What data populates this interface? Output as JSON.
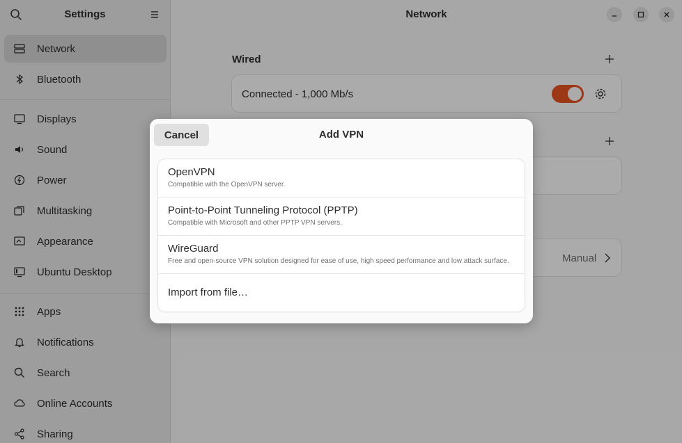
{
  "sidebar": {
    "title": "Settings",
    "items": [
      {
        "label": "Network",
        "icon": "network-icon",
        "active": true
      },
      {
        "label": "Bluetooth",
        "icon": "bluetooth-icon"
      },
      {
        "label": "Displays",
        "icon": "display-icon"
      },
      {
        "label": "Sound",
        "icon": "sound-icon"
      },
      {
        "label": "Power",
        "icon": "power-icon"
      },
      {
        "label": "Multitasking",
        "icon": "multitasking-icon"
      },
      {
        "label": "Appearance",
        "icon": "appearance-icon"
      },
      {
        "label": "Ubuntu Desktop",
        "icon": "ubuntu-desktop-icon"
      },
      {
        "label": "Apps",
        "icon": "apps-icon"
      },
      {
        "label": "Notifications",
        "icon": "bell-icon"
      },
      {
        "label": "Search",
        "icon": "search-icon"
      },
      {
        "label": "Online Accounts",
        "icon": "online-accounts-icon"
      },
      {
        "label": "Sharing",
        "icon": "share-icon"
      }
    ]
  },
  "main": {
    "title": "Network",
    "wired": {
      "label": "Wired",
      "status": "Connected - 1,000 Mb/s",
      "enabled": true
    },
    "proxy": {
      "value": "Manual"
    }
  },
  "dialog": {
    "title": "Add VPN",
    "cancel_label": "Cancel",
    "options": [
      {
        "name": "OpenVPN",
        "description": "Compatible with the OpenVPN server."
      },
      {
        "name": "Point-to-Point Tunneling Protocol (PPTP)",
        "description": "Compatible with Microsoft and other PPTP VPN servers."
      },
      {
        "name": "WireGuard",
        "description": "Free and open-source VPN solution designed for ease of use, high speed performance and low attack surface."
      }
    ],
    "import_label": "Import from file…"
  },
  "colors": {
    "accent": "#e95420"
  }
}
